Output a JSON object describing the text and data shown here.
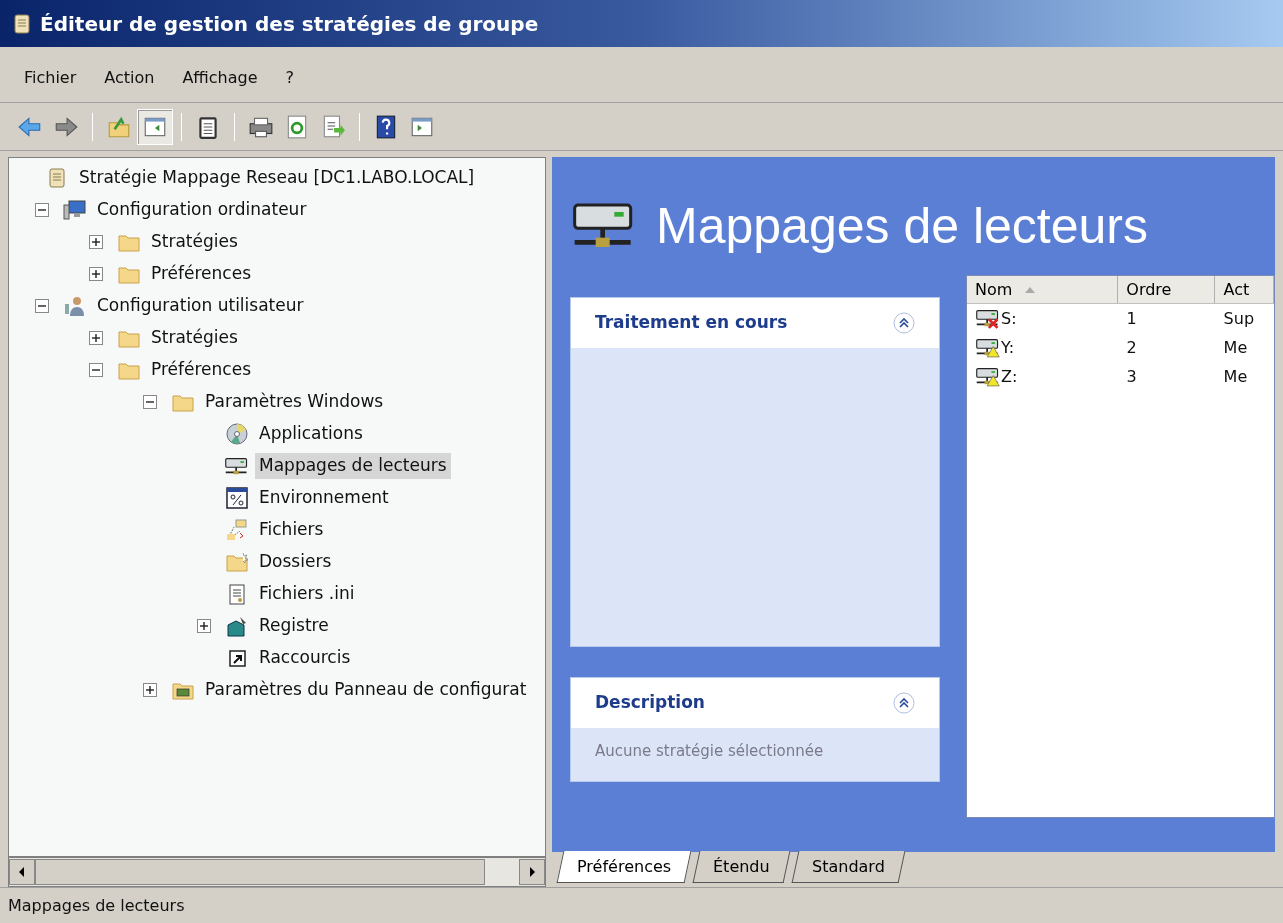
{
  "window": {
    "title": "Éditeur de gestion des stratégies de groupe"
  },
  "menu": [
    "Fichier",
    "Action",
    "Affichage",
    "?"
  ],
  "toolbar": [
    {
      "kind": "back",
      "pressed": false
    },
    {
      "kind": "forward",
      "pressed": false
    },
    {
      "kind": "sep"
    },
    {
      "kind": "up",
      "pressed": false
    },
    {
      "kind": "tree",
      "pressed": true
    },
    {
      "kind": "sep"
    },
    {
      "kind": "clipboard",
      "pressed": false
    },
    {
      "kind": "sep"
    },
    {
      "kind": "print",
      "pressed": false
    },
    {
      "kind": "refresh",
      "pressed": false
    },
    {
      "kind": "export",
      "pressed": false
    },
    {
      "kind": "sep"
    },
    {
      "kind": "help",
      "pressed": false
    },
    {
      "kind": "pane",
      "pressed": false
    }
  ],
  "tree": [
    {
      "label": "Stratégie Mappage Reseau [DC1.LABO.LOCAL]",
      "kind": "scroll",
      "selected": false,
      "children": [
        {
          "label": "Configuration ordinateur",
          "kind": "computer",
          "expanded": true,
          "selected": false,
          "children": [
            {
              "label": "Stratégies",
              "kind": "folder",
              "expanded": false,
              "selected": false
            },
            {
              "label": "Préférences",
              "kind": "folder",
              "expanded": false,
              "selected": false
            }
          ]
        },
        {
          "label": "Configuration utilisateur",
          "kind": "user",
          "expanded": true,
          "selected": false,
          "children": [
            {
              "label": "Stratégies",
              "kind": "folder",
              "expanded": false,
              "selected": false
            },
            {
              "label": "Préférences",
              "kind": "folder",
              "expanded": true,
              "selected": false,
              "children": [
                {
                  "label": "Paramètres Windows",
                  "kind": "folder",
                  "expanded": true,
                  "selected": false,
                  "children": [
                    {
                      "label": "Applications",
                      "kind": "disc",
                      "selected": false
                    },
                    {
                      "label": "Mappages de lecteurs",
                      "kind": "drive",
                      "selected": true
                    },
                    {
                      "label": "Environnement",
                      "kind": "percent",
                      "selected": false
                    },
                    {
                      "label": "Fichiers",
                      "kind": "files",
                      "selected": false
                    },
                    {
                      "label": "Dossiers",
                      "kind": "newfolder",
                      "selected": false
                    },
                    {
                      "label": "Fichiers .ini",
                      "kind": "ini",
                      "selected": false
                    },
                    {
                      "label": "Registre",
                      "kind": "registry",
                      "expanded": false,
                      "selected": false
                    },
                    {
                      "label": "Raccourcis",
                      "kind": "shortcut",
                      "selected": false
                    }
                  ]
                },
                {
                  "label": "Paramètres du Panneau de configurat",
                  "kind": "controlpanel",
                  "expanded": false,
                  "selected": false
                }
              ]
            }
          ]
        }
      ]
    }
  ],
  "content": {
    "heading": "Mappages de lecteurs",
    "cards": [
      {
        "title": "Traitement en cours",
        "kind": "tall"
      },
      {
        "title": "Description",
        "kind": "short",
        "text": "Aucune stratégie sélectionnée"
      }
    ],
    "list": {
      "columns": [
        "Nom",
        "Ordre",
        "Act"
      ],
      "rows": [
        {
          "cells": [
            "S:",
            "1",
            "Sup"
          ],
          "kind": "delete"
        },
        {
          "cells": [
            "Y:",
            "2",
            "Me"
          ],
          "kind": "update"
        },
        {
          "cells": [
            "Z:",
            "3",
            "Me"
          ],
          "kind": "update"
        }
      ]
    }
  },
  "tabs": [
    {
      "label": "Préférences",
      "selected": true
    },
    {
      "label": "Étendu",
      "selected": false
    },
    {
      "label": "Standard",
      "selected": false
    }
  ],
  "status_bar": "Mappages de lecteurs"
}
